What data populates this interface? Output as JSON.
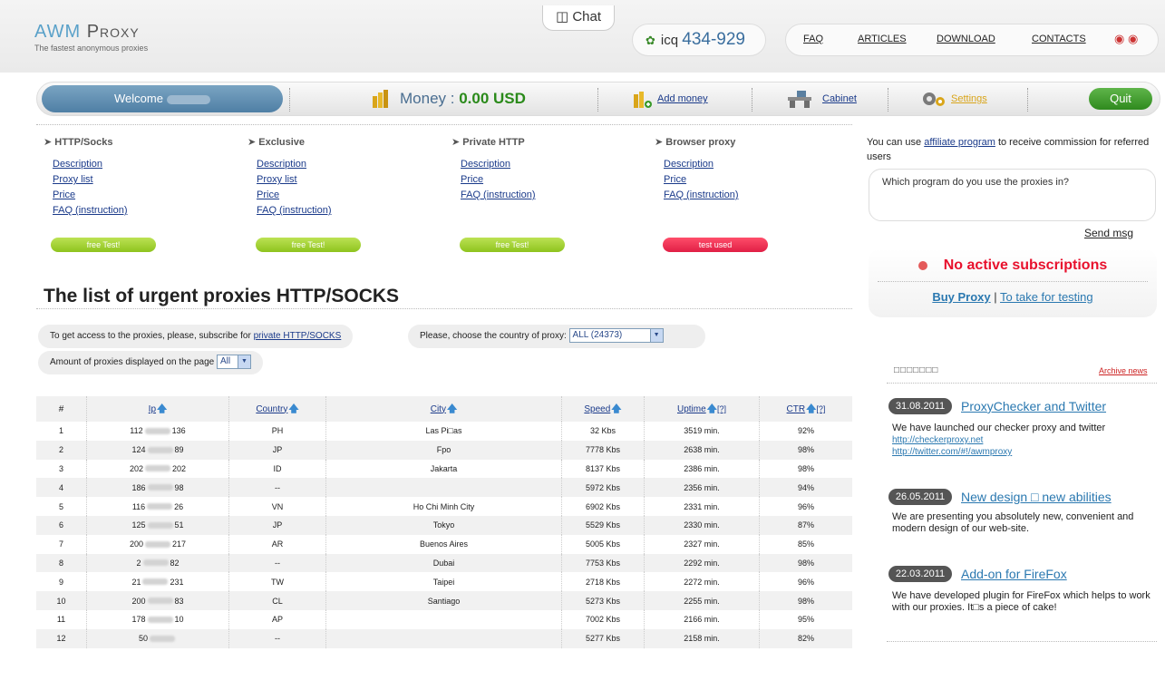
{
  "header": {
    "logo_main": "AWM",
    "logo_sub": "Proxy",
    "tagline": "The fastest anonymous proxies",
    "chat_label": "Chat",
    "icq_label": "icq",
    "icq_number": "434-929",
    "nav": [
      "FAQ",
      "ARTICLES",
      "DOWNLOAD",
      "CONTACTS"
    ]
  },
  "welcome_bar": {
    "welcome_label": "Welcome",
    "money_label": "Money :",
    "money_value": "0.00 USD",
    "add_money": "Add money",
    "cabinet": "Cabinet",
    "settings": "Settings",
    "quit": "Quit"
  },
  "products": [
    {
      "title": "HTTP/Socks",
      "links": [
        "Description",
        "Proxy list",
        "Price",
        "FAQ (instruction)"
      ],
      "button": "free Test!",
      "used": false
    },
    {
      "title": "Exclusive",
      "links": [
        "Description",
        "Proxy list",
        "Price",
        "FAQ (instruction)"
      ],
      "button": "free Test!",
      "used": false
    },
    {
      "title": "Private HTTP",
      "links": [
        "Description",
        "Price",
        "FAQ (instruction)"
      ],
      "button": "free Test!",
      "used": false
    },
    {
      "title": "Browser proxy",
      "links": [
        "Description",
        "Price",
        "FAQ (instruction)"
      ],
      "button": "test used",
      "used": true
    }
  ],
  "sidebar": {
    "affiliate_pre": "You can use",
    "affiliate_link": "affiliate program",
    "affiliate_post": "to receive commission for referred users",
    "message_placeholder": "Which program do you use the proxies in?",
    "send_msg": "Send msg",
    "no_subscriptions": "No active subscriptions",
    "buy_proxy": "Buy Proxy",
    "take_testing": "To take for testing"
  },
  "list": {
    "title": "The list of urgent proxies HTTP/SOCKS",
    "access_text": "To get access to the proxies, please, subscribe for",
    "access_link": "private HTTP/SOCKS",
    "country_label": "Please, choose the country of proxy:",
    "country_value": "ALL (24373)",
    "amount_label": "Amount of proxies displayed on the page",
    "amount_value": "All"
  },
  "table": {
    "headers": [
      "#",
      "Ip",
      "Country",
      "City",
      "Speed",
      "Uptime",
      "CTR"
    ],
    "help_mark": "[?]",
    "rows": [
      {
        "n": "1",
        "ip_a": "112",
        "ip_b": "136",
        "country": "PH",
        "city": "Las Pi□as",
        "speed": "32 Kbs",
        "uptime": "3519 min.",
        "ctr": "92%"
      },
      {
        "n": "2",
        "ip_a": "124",
        "ip_b": "89",
        "country": "JP",
        "city": "Fpo",
        "speed": "7778 Kbs",
        "uptime": "2638 min.",
        "ctr": "98%"
      },
      {
        "n": "3",
        "ip_a": "202",
        "ip_b": "202",
        "country": "ID",
        "city": "Jakarta",
        "speed": "8137 Kbs",
        "uptime": "2386 min.",
        "ctr": "98%"
      },
      {
        "n": "4",
        "ip_a": "186",
        "ip_b": "98",
        "country": "--",
        "city": "",
        "speed": "5972 Kbs",
        "uptime": "2356 min.",
        "ctr": "94%"
      },
      {
        "n": "5",
        "ip_a": "116",
        "ip_b": "26",
        "country": "VN",
        "city": "Ho Chi Minh City",
        "speed": "6902 Kbs",
        "uptime": "2331 min.",
        "ctr": "96%"
      },
      {
        "n": "6",
        "ip_a": "125",
        "ip_b": "51",
        "country": "JP",
        "city": "Tokyo",
        "speed": "5529 Kbs",
        "uptime": "2330 min.",
        "ctr": "87%"
      },
      {
        "n": "7",
        "ip_a": "200",
        "ip_b": "217",
        "country": "AR",
        "city": "Buenos Aires",
        "speed": "5005 Kbs",
        "uptime": "2327 min.",
        "ctr": "85%"
      },
      {
        "n": "8",
        "ip_a": "2",
        "ip_b": "82",
        "country": "--",
        "city": "Dubai",
        "speed": "7753 Kbs",
        "uptime": "2292 min.",
        "ctr": "98%"
      },
      {
        "n": "9",
        "ip_a": "21",
        "ip_b": "231",
        "country": "TW",
        "city": "Taipei",
        "speed": "2718 Kbs",
        "uptime": "2272 min.",
        "ctr": "96%"
      },
      {
        "n": "10",
        "ip_a": "200",
        "ip_b": "83",
        "country": "CL",
        "city": "Santiago",
        "speed": "5273 Kbs",
        "uptime": "2255 min.",
        "ctr": "98%"
      },
      {
        "n": "11",
        "ip_a": "178",
        "ip_b": "10",
        "country": "AP",
        "city": "",
        "speed": "7002 Kbs",
        "uptime": "2166 min.",
        "ctr": "95%"
      },
      {
        "n": "12",
        "ip_a": "50",
        "ip_b": "",
        "country": "--",
        "city": "",
        "speed": "5277 Kbs",
        "uptime": "2158 min.",
        "ctr": "82%"
      }
    ]
  },
  "news": {
    "header": "□□□□□□□",
    "archive": "Archive news",
    "items": [
      {
        "date": "31.08.2011",
        "title": "ProxyChecker and Twitter",
        "text": "We have launched our checker proxy and twitter",
        "links": [
          "http://checkerproxy.net",
          "http://twitter.com/#!/awmproxy"
        ]
      },
      {
        "date": "26.05.2011",
        "title": "New design □ new abilities",
        "text": "We are presenting you absolutely new, convenient and modern design of our web-site.",
        "links": []
      },
      {
        "date": "22.03.2011",
        "title": "Add-on for FireFox",
        "text": "We have developed plugin for FireFox which helps to work with our proxies. It□s a piece of cake!",
        "links": []
      }
    ]
  }
}
